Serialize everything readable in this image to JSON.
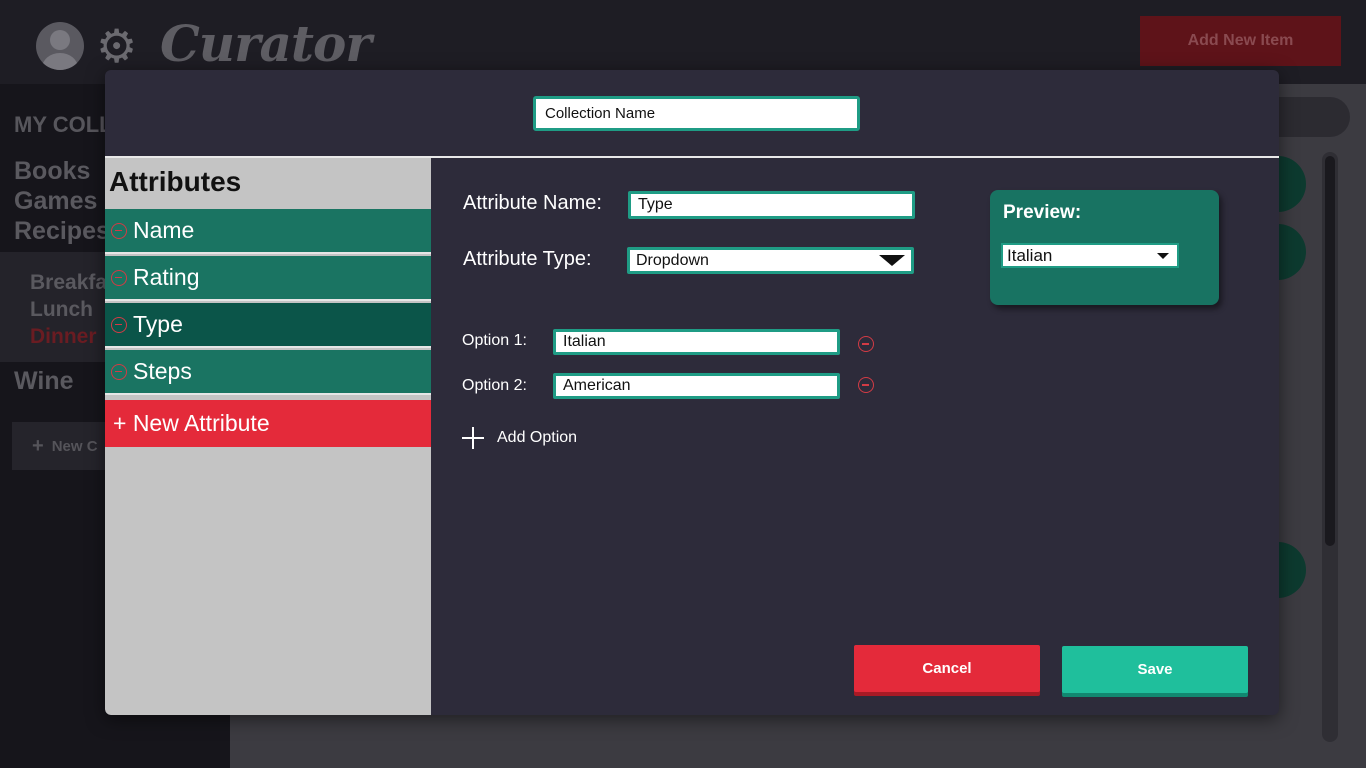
{
  "app": {
    "logo": "Curator",
    "add_new_item_label": "Add New Item"
  },
  "sidebar": {
    "heading": "MY COLL",
    "collections": [
      "Books",
      "Games",
      "Recipes",
      "Wine"
    ],
    "sub_items": [
      "Breakfa",
      "Lunch",
      "Dinner"
    ],
    "new_collection_label": "New C"
  },
  "modal": {
    "collection_name_value": "Collection Name",
    "attributes_title": "Attributes",
    "attributes": [
      {
        "label": "Name",
        "selected": false
      },
      {
        "label": "Rating",
        "selected": false
      },
      {
        "label": "Type",
        "selected": true
      },
      {
        "label": "Steps",
        "selected": false
      }
    ],
    "new_attribute_label": "+ New Attribute",
    "attribute_name_label": "Attribute Name:",
    "attribute_name_value": "Type",
    "attribute_type_label": "Attribute Type:",
    "attribute_type_value": "Dropdown",
    "options": [
      {
        "label": "Option 1:",
        "value": "Italian"
      },
      {
        "label": "Option 2:",
        "value": "American"
      }
    ],
    "add_option_label": "Add Option",
    "preview_title": "Preview:",
    "preview_value": "Italian",
    "cancel_label": "Cancel",
    "save_label": "Save"
  },
  "colors": {
    "accent_green": "#1a7462",
    "accent_red": "#e42a3a",
    "save_teal": "#1fbf9c",
    "modal_bg": "#2d2b3a"
  }
}
